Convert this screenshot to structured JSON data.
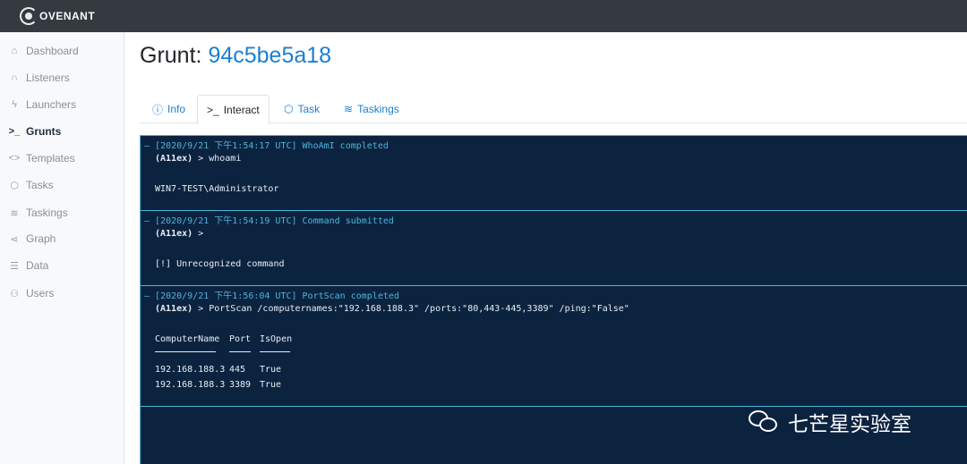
{
  "app": {
    "logo_text": "OVENANT"
  },
  "sidebar": {
    "items": [
      {
        "label": "Dashboard",
        "icon": "home-icon"
      },
      {
        "label": "Listeners",
        "icon": "headphones-icon"
      },
      {
        "label": "Launchers",
        "icon": "zap-icon"
      },
      {
        "label": "Grunts",
        "icon": "terminal-icon",
        "active": true
      },
      {
        "label": "Templates",
        "icon": "code-icon"
      },
      {
        "label": "Tasks",
        "icon": "box-icon"
      },
      {
        "label": "Taskings",
        "icon": "layers-icon"
      },
      {
        "label": "Graph",
        "icon": "share-icon"
      },
      {
        "label": "Data",
        "icon": "database-icon"
      },
      {
        "label": "Users",
        "icon": "users-icon"
      }
    ]
  },
  "page": {
    "title_prefix": "Grunt:",
    "grunt_id": "94c5be5a18"
  },
  "tabs": [
    {
      "label": "Info",
      "icon": "info-icon"
    },
    {
      "label": "Interact",
      "icon": "terminal-icon",
      "active": true
    },
    {
      "label": "Task",
      "icon": "box-icon"
    },
    {
      "label": "Taskings",
      "icon": "layers-icon"
    }
  ],
  "terminal": {
    "blocks": [
      {
        "header": "[2020/9/21 下午1:54:17 UTC] WhoAmI completed",
        "user": "(A11ex)",
        "command": " > whoami",
        "output": "WIN7-TEST\\Administrator"
      },
      {
        "header": "[2020/9/21 下午1:54:19 UTC] Command submitted",
        "user": "(A11ex)",
        "command": " >",
        "output": "[!] Unrecognized command"
      },
      {
        "header": "[2020/9/21 下午1:56:04 UTC] PortScan completed",
        "user": "(A11ex)",
        "command": " > PortScan /computernames:\"192.168.188.3\" /ports:\"80,443-445,3389\" /ping:\"False\"",
        "columns": [
          "ComputerName",
          "Port",
          "IsOpen"
        ],
        "rows": [
          [
            "192.168.188.3",
            "445",
            "True"
          ],
          [
            "192.168.188.3",
            "3389",
            "True"
          ]
        ]
      }
    ]
  },
  "watermark": {
    "text": "七芒星实验室",
    "icon": "wechat-icon"
  }
}
